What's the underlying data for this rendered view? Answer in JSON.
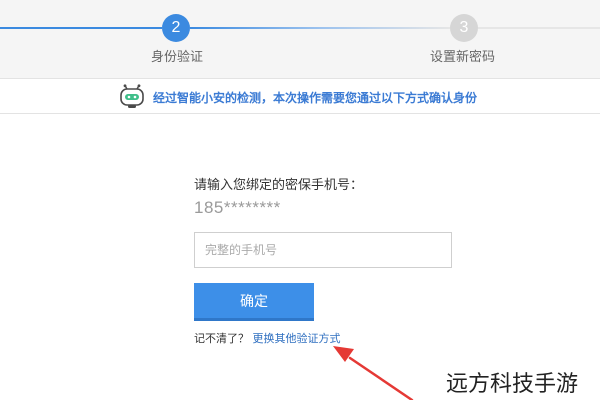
{
  "stepper": {
    "steps": [
      {
        "number": "2",
        "label": "身份验证",
        "state": "active"
      },
      {
        "number": "3",
        "label": "设置新密码",
        "state": "inactive"
      }
    ],
    "colors": {
      "active": "#3b8ae0",
      "inactive": "#d6d6d6"
    }
  },
  "notice": {
    "icon": "robot-icon",
    "text": "经过智能小安的检测，本次操作需要您通过以下方式确认身份",
    "color": "#3b7bd4"
  },
  "form": {
    "prompt": "请输入您绑定的密保手机号：",
    "masked_phone": "185********",
    "phone_input": {
      "placeholder": "完整的手机号",
      "value": ""
    },
    "confirm_label": "确定",
    "forgot_text": "记不清了？",
    "switch_link": "更换其他验证方式",
    "button_color": "#3d8fe8"
  },
  "annotation": {
    "arrow_icon": "red-arrow-icon",
    "color": "#e53935"
  },
  "watermark": {
    "text": "远方科技手游"
  }
}
